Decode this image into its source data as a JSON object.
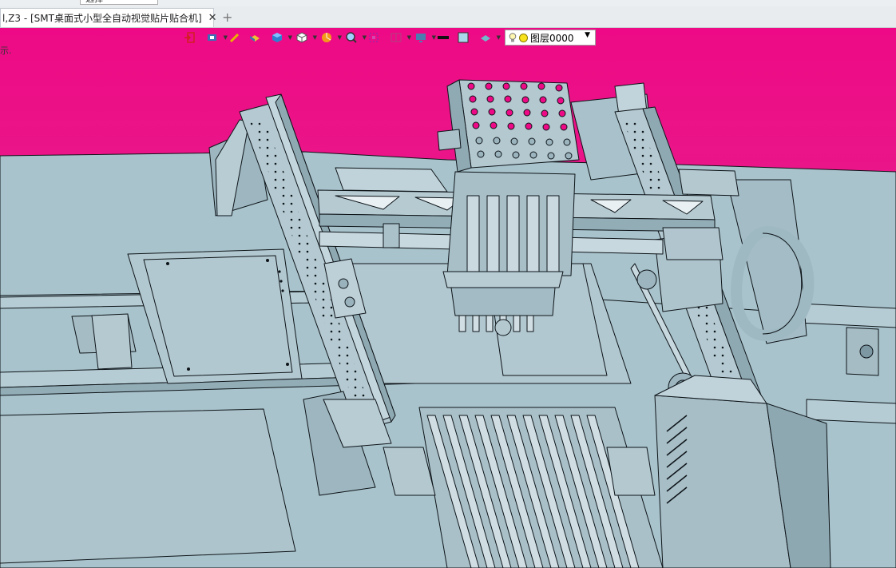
{
  "tab": {
    "title": "l,Z3 - [SMT桌面式小型全自动视觉贴片贴合机]",
    "close": "✕",
    "new": "+"
  },
  "top_partial": {
    "field_value": "选择"
  },
  "side_text": "示.",
  "toolbar": {
    "items": [
      "exit-icon",
      "view-icon",
      "sketch-icon",
      "shade-icon",
      "cube-icon",
      "wire-cube-icon",
      "pie-icon",
      "zoom-icon",
      "fit-icon",
      "section-icon",
      "display-icon",
      "line-color-icon",
      "fill-color-icon",
      "material-icon"
    ],
    "layer_label": "图层0000"
  },
  "colors": {
    "background_top": "#ee0a86",
    "background_bottom": "#a9c3cc",
    "model": "#a7bfc8",
    "edge": "#0d1418"
  }
}
